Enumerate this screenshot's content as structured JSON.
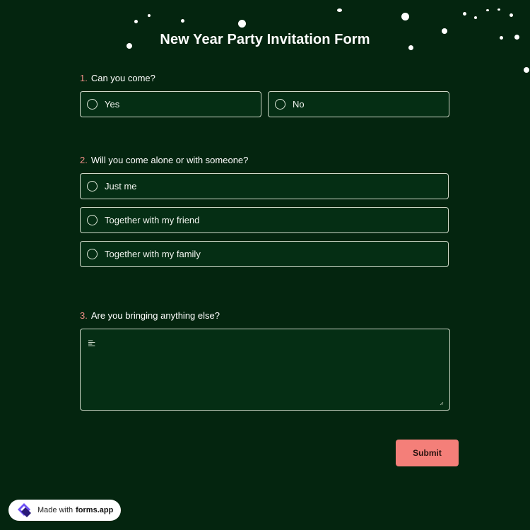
{
  "form": {
    "title": "New Year Party Invitation Form",
    "questions": [
      {
        "number": "1.",
        "text": "Can you come?",
        "options": [
          "Yes",
          "No"
        ]
      },
      {
        "number": "2.",
        "text": "Will you come alone or with someone?",
        "options": [
          "Just me",
          "Together with my friend",
          "Together with my family"
        ]
      },
      {
        "number": "3.",
        "text": "Are you bringing anything else?"
      }
    ],
    "submit_label": "Submit"
  },
  "badge": {
    "prefix": "Made with",
    "brand": "forms.app"
  },
  "colors": {
    "background": "#04250f",
    "accent": "#f47f79",
    "border": "#cfd8c8",
    "text": "#ffffff"
  }
}
